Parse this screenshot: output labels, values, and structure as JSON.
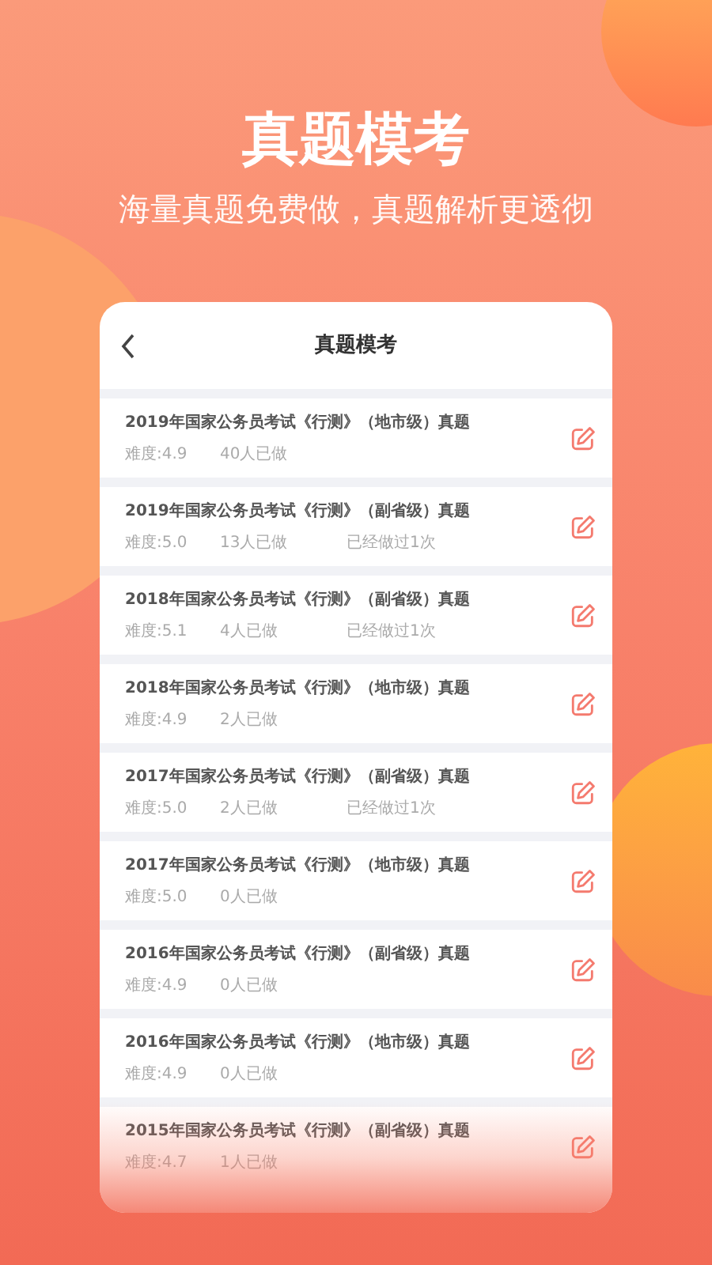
{
  "headline": "真题模考",
  "subtitle": "海量真题免费做，真题解析更透彻",
  "screen": {
    "title": "真题模考",
    "items": [
      {
        "title": "2019年国家公务员考试《行测》（地市级）真题",
        "difficulty": "难度:4.9",
        "done_count": "40人已做"
      },
      {
        "title": "2019年国家公务员考试《行测》（副省级）真题",
        "difficulty": "难度:5.0",
        "done_count": "13人已做",
        "history": "已经做过1次"
      },
      {
        "title": "2018年国家公务员考试《行测》（副省级）真题",
        "difficulty": "难度:5.1",
        "done_count": "4人已做",
        "history": "已经做过1次"
      },
      {
        "title": "2018年国家公务员考试《行测》（地市级）真题",
        "difficulty": "难度:4.9",
        "done_count": "2人已做"
      },
      {
        "title": "2017年国家公务员考试《行测》（副省级）真题",
        "difficulty": "难度:5.0",
        "done_count": "2人已做",
        "history": "已经做过1次"
      },
      {
        "title": "2017年国家公务员考试《行测》（地市级）真题",
        "difficulty": "难度:5.0",
        "done_count": "0人已做"
      },
      {
        "title": "2016年国家公务员考试《行测》（副省级）真题",
        "difficulty": "难度:4.9",
        "done_count": "0人已做"
      },
      {
        "title": "2016年国家公务员考试《行测》（地市级）真题",
        "difficulty": "难度:4.9",
        "done_count": "0人已做"
      },
      {
        "title": "2015年国家公务员考试《行测》（副省级）真题",
        "difficulty": "难度:4.7",
        "done_count": "1人已做"
      }
    ]
  }
}
